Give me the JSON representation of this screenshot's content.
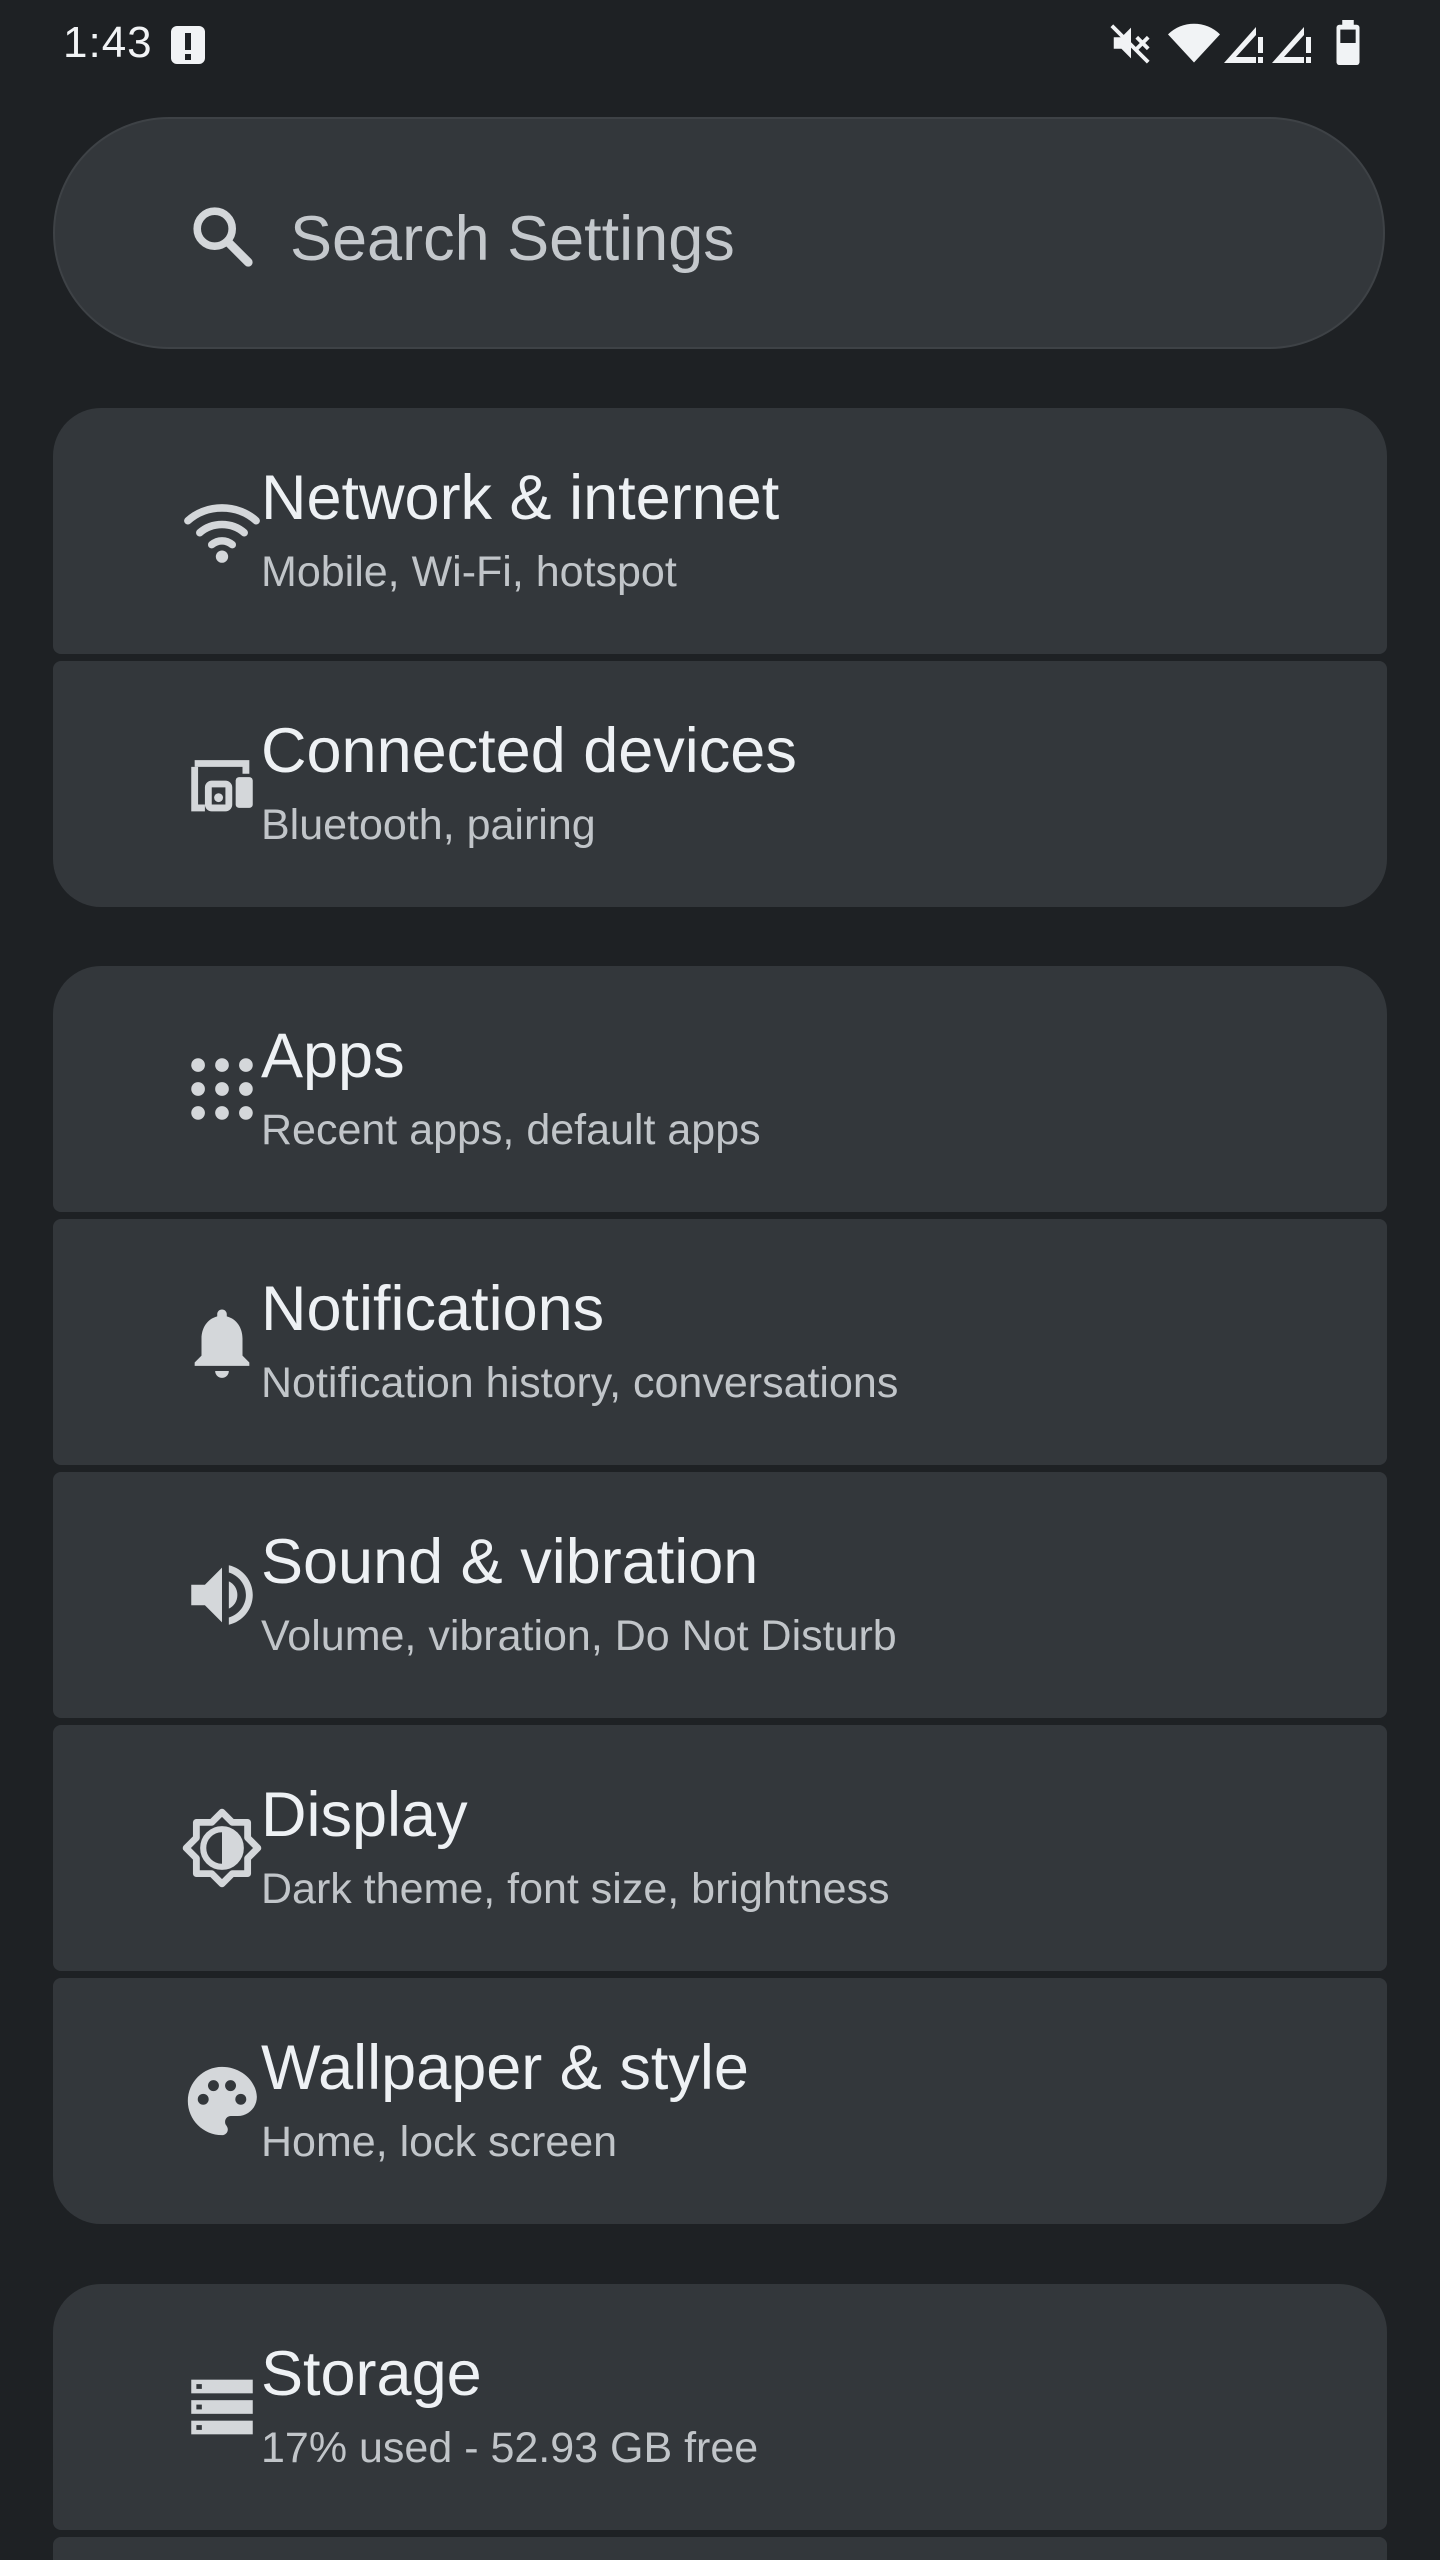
{
  "status_bar": {
    "time": "1:43",
    "icons": [
      "alert-notification-icon",
      "mute-icon",
      "wifi-icon",
      "signal-icon",
      "signal-icon",
      "battery-icon"
    ]
  },
  "search": {
    "placeholder": "Search Settings"
  },
  "settings": [
    {
      "title": "Network & internet",
      "subtitle": "Mobile, Wi-Fi, hotspot",
      "icon": "wifi-icon"
    },
    {
      "title": "Connected devices",
      "subtitle": "Bluetooth, pairing",
      "icon": "devices-icon"
    },
    {
      "title": "Apps",
      "subtitle": "Recent apps, default apps",
      "icon": "apps-grid-icon"
    },
    {
      "title": "Notifications",
      "subtitle": "Notification history, conversations",
      "icon": "bell-icon"
    },
    {
      "title": "Sound & vibration",
      "subtitle": "Volume, vibration, Do Not Disturb",
      "icon": "speaker-icon"
    },
    {
      "title": "Display",
      "subtitle": "Dark theme, font size, brightness",
      "icon": "brightness-icon"
    },
    {
      "title": "Wallpaper & style",
      "subtitle": "Home, lock screen",
      "icon": "palette-icon"
    },
    {
      "title": "Storage",
      "subtitle": "17% used - 52.93 GB free",
      "icon": "storage-icon"
    }
  ],
  "colors": {
    "background": "#1e2124",
    "card": "#33373b",
    "text": "#eef1f4",
    "subtext": "#c1c5c9"
  }
}
